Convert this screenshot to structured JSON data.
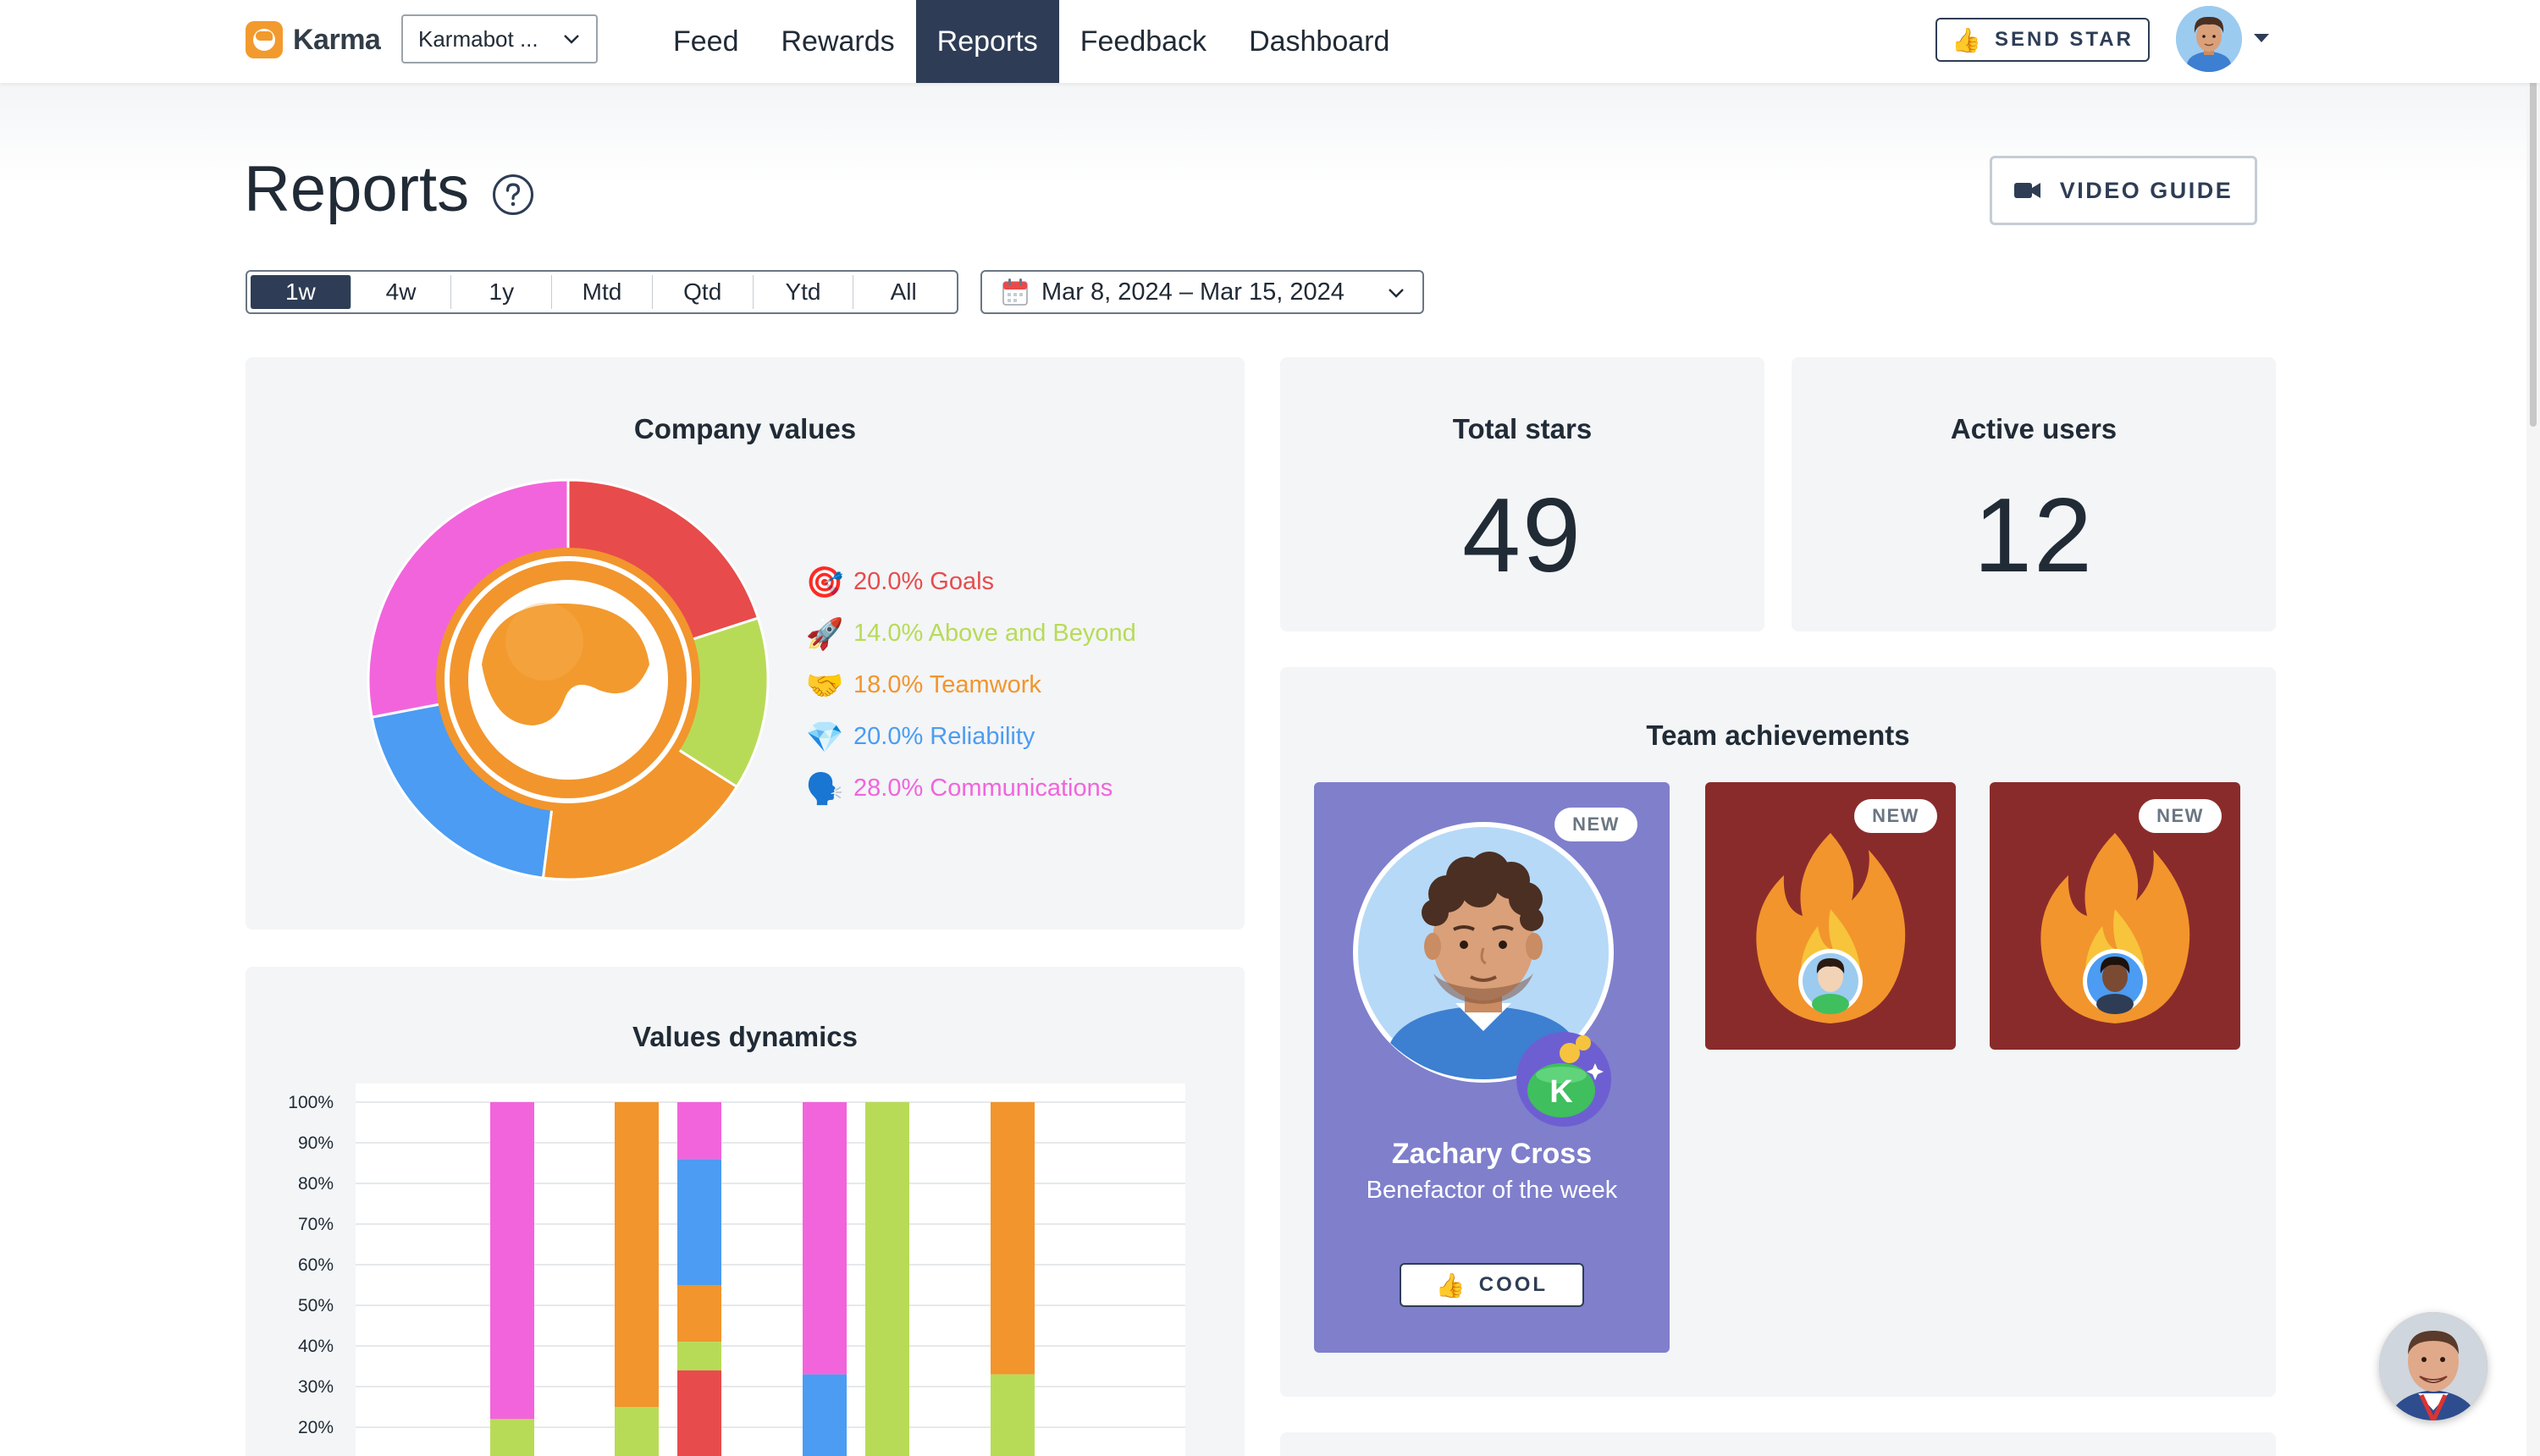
{
  "nav": {
    "brand": "Karma",
    "workspace": "Karmabot ...",
    "links": [
      "Feed",
      "Rewards",
      "Reports",
      "Feedback",
      "Dashboard"
    ],
    "active_link": "Reports",
    "send_star_label": "SEND STAR",
    "send_star_icon": "thumbs-up-icon"
  },
  "header": {
    "title": "Reports",
    "video_guide_label": "VIDEO GUIDE"
  },
  "filters": {
    "periods": [
      "1w",
      "4w",
      "1y",
      "Mtd",
      "Qtd",
      "Ytd",
      "All"
    ],
    "active_period": "1w",
    "date_range": "Mar 8, 2024 – Mar 15, 2024"
  },
  "company_values": {
    "title": "Company values",
    "items": [
      {
        "label": "20.0% Goals",
        "emoji": "🎯",
        "color": "#e84b4b"
      },
      {
        "label": "14.0% Above and Beyond",
        "emoji": "🚀",
        "color": "#b8db57"
      },
      {
        "label": "18.0% Teamwork",
        "emoji": "🤝",
        "color": "#f2952d"
      },
      {
        "label": "20.0% Reliability",
        "emoji": "💎",
        "color": "#4b9cf2"
      },
      {
        "label": "28.0% Communications",
        "emoji": "🗣️",
        "color": "#f264dc"
      }
    ]
  },
  "chart_data": {
    "type": "pie",
    "labels": [
      "Goals",
      "Above and Beyond",
      "Teamwork",
      "Reliability",
      "Communications"
    ],
    "values": [
      20.0,
      14.0,
      18.0,
      20.0,
      28.0
    ],
    "colors": [
      "#e84b4b",
      "#b8db57",
      "#f2952d",
      "#4b9cf2",
      "#f264dc"
    ]
  },
  "values_dynamics": {
    "title": "Values dynamics",
    "type": "bar",
    "stacked": true,
    "y_ticks": [
      "100%",
      "90%",
      "80%",
      "70%",
      "60%",
      "50%",
      "40%",
      "30%",
      "20%"
    ],
    "series_colors": {
      "Goals": "#e84b4b",
      "Above and Beyond": "#b8db57",
      "Teamwork": "#f2952d",
      "Reliability": "#4b9cf2",
      "Communications": "#f264dc"
    },
    "bars": [
      {
        "segments": [
          {
            "series": "Communications",
            "from": 22,
            "to": 100
          },
          {
            "series": "Above and Beyond",
            "from": 0,
            "to": 22
          }
        ]
      },
      {
        "segments": [
          {
            "series": "Teamwork",
            "from": 25,
            "to": 100
          },
          {
            "series": "Above and Beyond",
            "from": 0,
            "to": 25
          }
        ]
      },
      {
        "segments": [
          {
            "series": "Communications",
            "from": 86,
            "to": 100
          },
          {
            "series": "Reliability",
            "from": 55,
            "to": 86
          },
          {
            "series": "Teamwork",
            "from": 41,
            "to": 55
          },
          {
            "series": "Above and Beyond",
            "from": 34,
            "to": 41
          },
          {
            "series": "Goals",
            "from": 0,
            "to": 34
          }
        ]
      },
      {
        "segments": [
          {
            "series": "Communications",
            "from": 33,
            "to": 100
          },
          {
            "series": "Reliability",
            "from": 0,
            "to": 33
          }
        ]
      },
      {
        "segments": [
          {
            "series": "Above and Beyond",
            "from": 0,
            "to": 100
          }
        ]
      },
      {
        "segments": [
          {
            "series": "Teamwork",
            "from": 33,
            "to": 100
          },
          {
            "series": "Above and Beyond",
            "from": 0,
            "to": 33
          }
        ]
      }
    ]
  },
  "stats": {
    "total_stars_label": "Total stars",
    "total_stars": "49",
    "active_users_label": "Active users",
    "active_users": "12"
  },
  "team_achievements": {
    "title": "Team achievements",
    "new_badge": "NEW",
    "featured": {
      "name": "Zachary Cross",
      "subtitle": "Benefactor of the week",
      "button_label": "COOL",
      "button_icon": "thumbs-up-icon",
      "bg_color": "#7f7fcc"
    },
    "streak_bg_color": "#8a2b2b"
  }
}
